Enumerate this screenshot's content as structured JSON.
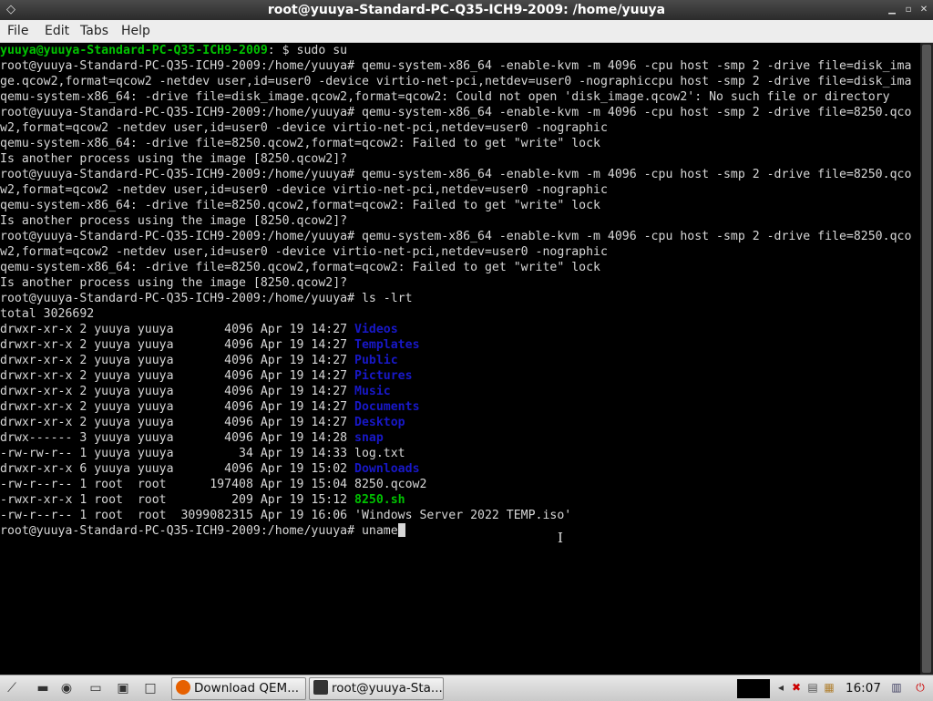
{
  "window": {
    "title": "root@yuuya-Standard-PC-Q35-ICH9-2009: /home/yuuya"
  },
  "menu": [
    "File",
    "Edit",
    "Tabs",
    "Help"
  ],
  "terminal": {
    "lines": [
      [
        {
          "t": "yuuya@yuuya-Standard-PC-Q35-ICH9-2009",
          "c": "g"
        },
        {
          "t": ": $ sudo su"
        }
      ],
      [
        {
          "t": "root@yuuya-Standard-PC-Q35-ICH9-2009:/home/yuuya# qemu-system-x86_64 -enable-kvm -m 4096 -cpu host -smp 2 -drive file=disk_ima"
        }
      ],
      [
        {
          "t": "ge.qcow2,format=qcow2 -netdev user,id=user0 -device virtio-net-pci,netdev=user0 -nographiccpu host -smp 2 -drive file=disk_ima"
        }
      ],
      [
        {
          "t": "qemu-system-x86_64: -drive file=disk_image.qcow2,format=qcow2: Could not open 'disk_image.qcow2': No such file or directory"
        }
      ],
      [
        {
          "t": "root@yuuya-Standard-PC-Q35-ICH9-2009:/home/yuuya# qemu-system-x86_64 -enable-kvm -m 4096 -cpu host -smp 2 -drive file=8250.qco"
        }
      ],
      [
        {
          "t": "w2,format=qcow2 -netdev user,id=user0 -device virtio-net-pci,netdev=user0 -nographic"
        }
      ],
      [
        {
          "t": "qemu-system-x86_64: -drive file=8250.qcow2,format=qcow2: Failed to get \"write\" lock"
        }
      ],
      [
        {
          "t": "Is another process using the image [8250.qcow2]?"
        }
      ],
      [
        {
          "t": "root@yuuya-Standard-PC-Q35-ICH9-2009:/home/yuuya# qemu-system-x86_64 -enable-kvm -m 4096 -cpu host -smp 2 -drive file=8250.qco"
        }
      ],
      [
        {
          "t": "w2,format=qcow2 -netdev user,id=user0 -device virtio-net-pci,netdev=user0 -nographic"
        }
      ],
      [
        {
          "t": "qemu-system-x86_64: -drive file=8250.qcow2,format=qcow2: Failed to get \"write\" lock"
        }
      ],
      [
        {
          "t": "Is another process using the image [8250.qcow2]?"
        }
      ],
      [
        {
          "t": "root@yuuya-Standard-PC-Q35-ICH9-2009:/home/yuuya# qemu-system-x86_64 -enable-kvm -m 4096 -cpu host -smp 2 -drive file=8250.qco"
        }
      ],
      [
        {
          "t": "w2,format=qcow2 -netdev user,id=user0 -device virtio-net-pci,netdev=user0 -nographic"
        }
      ],
      [
        {
          "t": "qemu-system-x86_64: -drive file=8250.qcow2,format=qcow2: Failed to get \"write\" lock"
        }
      ],
      [
        {
          "t": "Is another process using the image [8250.qcow2]?"
        }
      ],
      [
        {
          "t": "root@yuuya-Standard-PC-Q35-ICH9-2009:/home/yuuya# ls -lrt"
        }
      ],
      [
        {
          "t": "total 3026692"
        }
      ],
      [
        {
          "t": "drwxr-xr-x 2 yuuya yuuya       4096 Apr 19 14:27 "
        },
        {
          "t": "Videos",
          "c": "b"
        }
      ],
      [
        {
          "t": "drwxr-xr-x 2 yuuya yuuya       4096 Apr 19 14:27 "
        },
        {
          "t": "Templates",
          "c": "b"
        }
      ],
      [
        {
          "t": "drwxr-xr-x 2 yuuya yuuya       4096 Apr 19 14:27 "
        },
        {
          "t": "Public",
          "c": "b"
        }
      ],
      [
        {
          "t": "drwxr-xr-x 2 yuuya yuuya       4096 Apr 19 14:27 "
        },
        {
          "t": "Pictures",
          "c": "b"
        }
      ],
      [
        {
          "t": "drwxr-xr-x 2 yuuya yuuya       4096 Apr 19 14:27 "
        },
        {
          "t": "Music",
          "c": "b"
        }
      ],
      [
        {
          "t": "drwxr-xr-x 2 yuuya yuuya       4096 Apr 19 14:27 "
        },
        {
          "t": "Documents",
          "c": "b"
        }
      ],
      [
        {
          "t": "drwxr-xr-x 2 yuuya yuuya       4096 Apr 19 14:27 "
        },
        {
          "t": "Desktop",
          "c": "b"
        }
      ],
      [
        {
          "t": "drwx------ 3 yuuya yuuya       4096 Apr 19 14:28 "
        },
        {
          "t": "snap",
          "c": "b"
        }
      ],
      [
        {
          "t": "-rw-rw-r-- 1 yuuya yuuya         34 Apr 19 14:33 log.txt"
        }
      ],
      [
        {
          "t": "drwxr-xr-x 6 yuuya yuuya       4096 Apr 19 15:02 "
        },
        {
          "t": "Downloads",
          "c": "b"
        }
      ],
      [
        {
          "t": "-rw-r--r-- 1 root  root      197408 Apr 19 15:04 8250.qcow2"
        }
      ],
      [
        {
          "t": "-rwxr-xr-x 1 root  root         209 Apr 19 15:12 "
        },
        {
          "t": "8250.sh",
          "c": "g"
        }
      ],
      [
        {
          "t": "-rw-r--r-- 1 root  root  3099082315 Apr 19 16:06 'Windows Server 2022 TEMP.iso'"
        }
      ],
      [
        {
          "t": "root@yuuya-Standard-PC-Q35-ICH9-2009:/home/yuuya# uname"
        },
        {
          "t": "",
          "c": "cursor"
        }
      ]
    ]
  },
  "taskbar": {
    "tasks": [
      {
        "label": "Download QEM...",
        "icon": "firefox-icon"
      },
      {
        "label": "root@yuuya-Sta...",
        "icon": "terminal-icon"
      }
    ],
    "clock": "16:07"
  },
  "colors": {
    "prompt_user": "#00c200",
    "directory": "#1818c8",
    "executable": "#00c200"
  }
}
